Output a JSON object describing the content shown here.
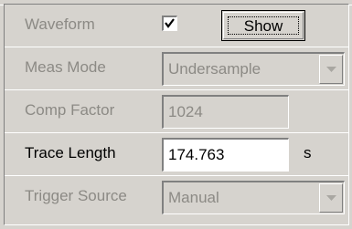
{
  "rows": {
    "waveform": {
      "label": "Waveform",
      "checked": true,
      "button_label": "Show"
    },
    "meas_mode": {
      "label": "Meas Mode",
      "value": "Undersample",
      "arrow_icon": "chevron-down-icon"
    },
    "comp_factor": {
      "label": "Comp Factor",
      "value": "1024"
    },
    "trace_length": {
      "label": "Trace Length",
      "value": "174.763",
      "unit": "s"
    },
    "trigger_source": {
      "label": "Trigger Source",
      "value": "Manual",
      "arrow_icon": "chevron-down-icon"
    }
  },
  "colors": {
    "panel_bg": "#d6d3ce",
    "disabled_text": "#8c8a85",
    "enabled_text": "#000000",
    "field_bg": "#ffffff"
  }
}
